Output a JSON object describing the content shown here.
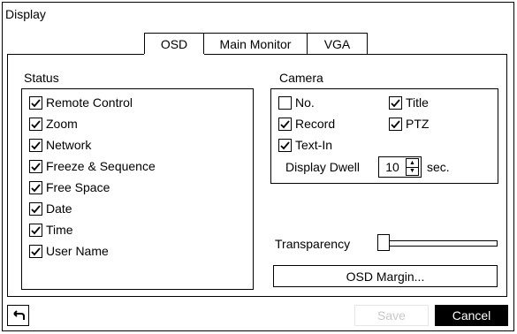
{
  "window": {
    "title": "Display"
  },
  "tabs": [
    {
      "label": "OSD",
      "active": true
    },
    {
      "label": "Main Monitor",
      "active": false
    },
    {
      "label": "VGA",
      "active": false
    }
  ],
  "status": {
    "label": "Status",
    "items": [
      {
        "label": "Remote Control",
        "checked": true
      },
      {
        "label": "Zoom",
        "checked": true
      },
      {
        "label": "Network",
        "checked": true
      },
      {
        "label": "Freeze & Sequence",
        "checked": true
      },
      {
        "label": "Free Space",
        "checked": true
      },
      {
        "label": "Date",
        "checked": true
      },
      {
        "label": "Time",
        "checked": true
      },
      {
        "label": "User Name",
        "checked": true
      }
    ]
  },
  "camera": {
    "label": "Camera",
    "items": [
      {
        "label": "No.",
        "checked": false
      },
      {
        "label": "Title",
        "checked": true
      },
      {
        "label": "Record",
        "checked": true
      },
      {
        "label": "PTZ",
        "checked": true
      },
      {
        "label": "Text-In",
        "checked": true
      }
    ],
    "dwell_label": "Display Dwell",
    "dwell_value": "10",
    "dwell_unit": "sec."
  },
  "transparency": {
    "label": "Transparency",
    "level": 0
  },
  "osd_margin_label": "OSD Margin...",
  "footer": {
    "back_icon": "back-arrow-icon",
    "save_label": "Save",
    "cancel_label": "Cancel"
  }
}
